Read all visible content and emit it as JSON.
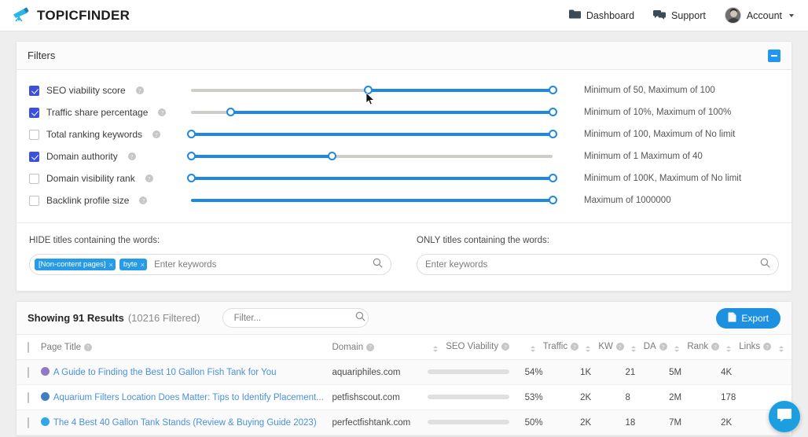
{
  "header": {
    "logo_icon": "telescope-icon",
    "brand": "TOPICFINDER",
    "nav": [
      {
        "label": "Dashboard",
        "icon": "folder-icon"
      },
      {
        "label": "Support",
        "icon": "chat-bubbles-icon"
      }
    ],
    "account": {
      "label": "Account",
      "icon": "avatar-icon",
      "caret": "caret-down-icon"
    }
  },
  "filters": {
    "title": "Filters",
    "collapse_icon": "minus-icon",
    "accent_color": "#1e88e5",
    "checkbox_color": "#3c50e0",
    "rows": [
      {
        "label": "SEO viability score",
        "checked": true,
        "desc": "Minimum of 50, Maximum of 100",
        "min_pct": 49,
        "max_pct": 100
      },
      {
        "label": "Traffic share percentage",
        "checked": true,
        "desc": "Minimum of 10%, Maximum of 100%",
        "min_pct": 11,
        "max_pct": 100
      },
      {
        "label": "Total ranking keywords",
        "checked": false,
        "desc": "Minimum of 100, Maximum of No limit",
        "min_pct": 0,
        "max_pct": 100
      },
      {
        "label": "Domain authority",
        "checked": true,
        "desc": "Minimum of 1 Maximum of 40",
        "min_pct": 0,
        "max_pct": 39
      },
      {
        "label": "Domain visibility rank",
        "checked": false,
        "desc": "Minimum of 100K, Maximum of No limit",
        "min_pct": 0,
        "max_pct": 100
      },
      {
        "label": "Backlink profile size",
        "checked": false,
        "desc": "Maximum of 1000000",
        "min_pct": null,
        "max_pct": 100
      }
    ],
    "hide": {
      "label": "HIDE titles containing the words:",
      "tags": [
        "[Non-content pages]",
        "byte"
      ],
      "placeholder": "Enter keywords",
      "search_icon": "search-icon"
    },
    "only": {
      "label": "ONLY titles containing the words:",
      "tags": [],
      "placeholder": "Enter keywords",
      "search_icon": "search-icon"
    }
  },
  "results": {
    "count_text": "Showing 91 Results",
    "filtered_text": "(10216 Filtered)",
    "filter_placeholder": "Filter...",
    "filter_icon": "search-icon",
    "export_label": "Export",
    "export_icon": "document-icon",
    "columns": [
      "Page Title",
      "Domain",
      "SEO Viability",
      "Traffic",
      "KW",
      "DA",
      "Rank",
      "Links"
    ],
    "rows": [
      {
        "title": "A Guide to Finding the Best 10 Gallon Fish Tank for You",
        "favicon_color": "#8e7bc3",
        "domain": "aquariphiles.com",
        "seo_pct": 54,
        "seo": "54%",
        "traffic": "1K",
        "kw": "21",
        "da": "5M",
        "rank": "4K",
        "links": ""
      },
      {
        "title": "Aquarium Filters Location Does Matter: Tips to Identify Placement...",
        "favicon_color": "#3f7fbf",
        "domain": "petfishscout.com",
        "seo_pct": 53,
        "seo": "53%",
        "traffic": "2K",
        "kw": "8",
        "da": "2M",
        "rank": "178",
        "links": ""
      },
      {
        "title": "The 4 Best 40 Gallon Tank Stands (Review & Buying Guide 2023)",
        "favicon_color": "#2da8e8",
        "domain": "perfectfishtank.com",
        "seo_pct": 50,
        "seo": "50%",
        "traffic": "2K",
        "kw": "18",
        "da": "7M",
        "rank": "2K",
        "links": ""
      }
    ]
  },
  "chat": {
    "icon": "chat-bubble-icon"
  }
}
